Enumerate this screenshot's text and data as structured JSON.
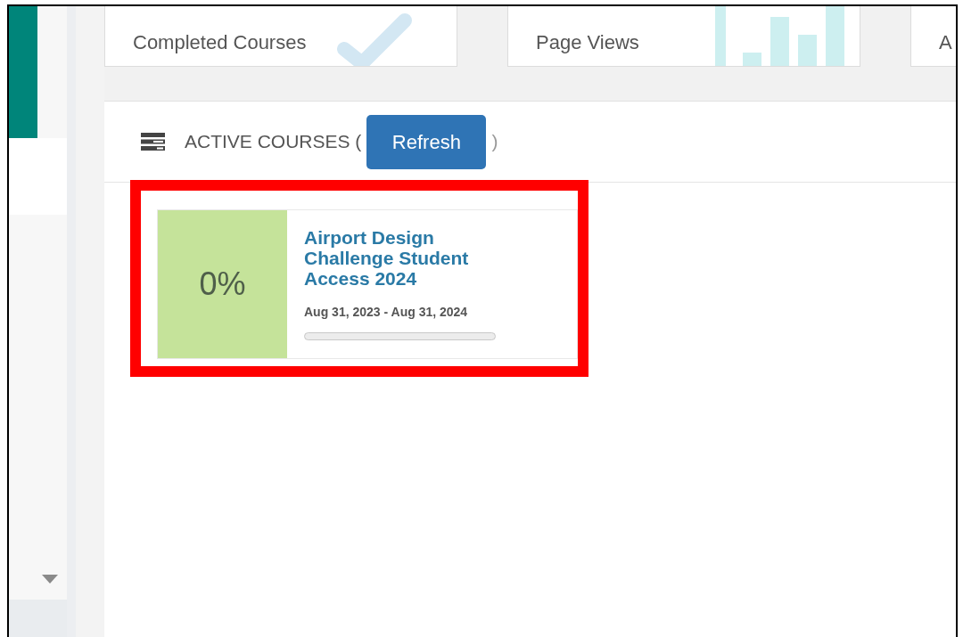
{
  "stat_cards": [
    {
      "label": "Completed Courses",
      "kind": "check"
    },
    {
      "label": "Page Views",
      "kind": "bars"
    },
    {
      "label": "A",
      "kind": "none"
    }
  ],
  "active_courses": {
    "heading": "ACTIVE COURSES (",
    "button": "Refresh",
    "closing": ")"
  },
  "courses": [
    {
      "progress": "0%",
      "title": "Airport Design Challenge Student Access 2024",
      "dates": "Aug 31, 2023 - Aug 31, 2024",
      "level": 0,
      "highlighted": true
    }
  ]
}
